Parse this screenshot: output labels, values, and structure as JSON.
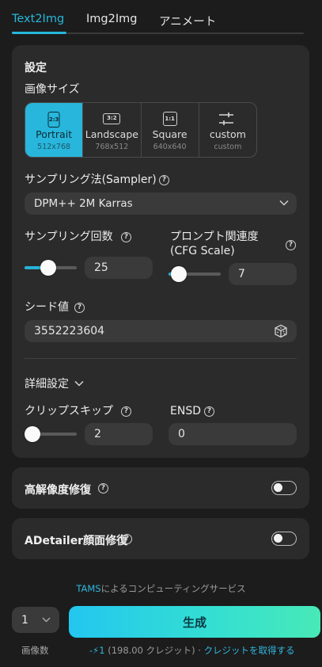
{
  "tabs": [
    {
      "label": "Text2Img",
      "active": true
    },
    {
      "label": "Img2Img",
      "active": false
    },
    {
      "label": "アニメート",
      "active": false
    }
  ],
  "settings": {
    "title": "設定",
    "image_size": {
      "label": "画像サイズ",
      "options": [
        {
          "ratio": "2:3",
          "name": "Portrait",
          "dims": "512x768",
          "selected": true
        },
        {
          "ratio": "3:2",
          "name": "Landscape",
          "dims": "768x512",
          "selected": false
        },
        {
          "ratio": "1:1",
          "name": "Square",
          "dims": "640x640",
          "selected": false
        },
        {
          "ratio": "",
          "name": "custom",
          "dims": "custom",
          "selected": false,
          "icon": "sliders-icon"
        }
      ]
    },
    "sampler": {
      "label": "サンプリング法(Sampler)",
      "value": "DPM++ 2M Karras"
    },
    "steps": {
      "label": "サンプリング回数",
      "value": "25",
      "level": 0.45
    },
    "cfg": {
      "label_line1": "プロンプト関連度",
      "label_line2": "(CFG Scale)",
      "value": "7",
      "level": 0.2
    },
    "seed": {
      "label": "シード値",
      "value": "3552223604"
    },
    "advanced": {
      "label": "詳細設定",
      "clip_skip": {
        "label": "クリップスキップ",
        "value": "2",
        "level": 0.15
      },
      "ensd": {
        "label": "ENSD",
        "value": "0"
      }
    }
  },
  "hires_fix": {
    "label": "高解像度修復",
    "enabled": false
  },
  "adetailer": {
    "label": "ADetailer顔面修復",
    "enabled": false
  },
  "footer": {
    "provider_brand": "TAMS",
    "provider_text": "によるコンピューティングサービス",
    "count_value": "1",
    "count_label": "画像数",
    "generate_label": "生成",
    "cost_prefix": "-",
    "cost_value": "1",
    "credits_text": "(198.00 クレジット) ·",
    "get_credits_link": "クレジットを取得する"
  },
  "colors": {
    "accent": "#28b6dc",
    "panel": "#2b2b2b",
    "background": "#1c1c1c"
  }
}
